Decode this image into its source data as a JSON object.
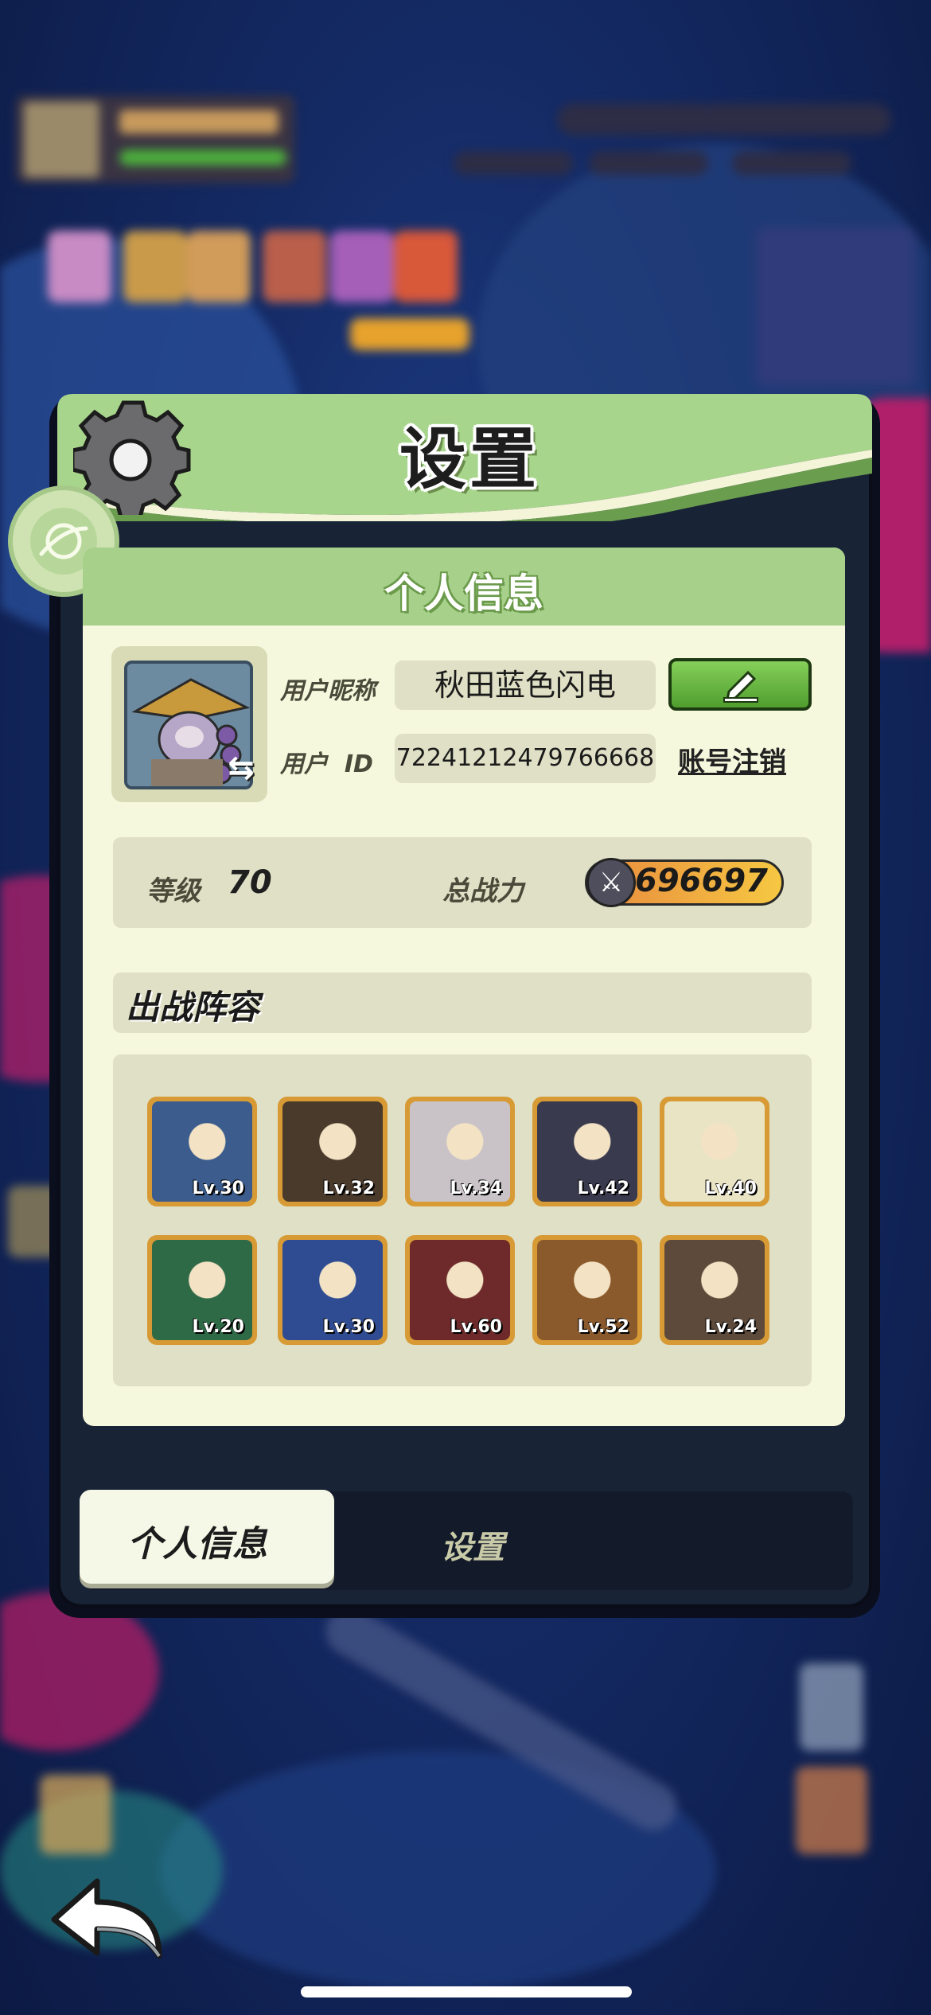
{
  "dialog": {
    "title": "设置",
    "card_title": "个人信息",
    "gear_icon": "gear-icon",
    "badge_icon": "planet-icon"
  },
  "profile": {
    "nickname_label": "用户昵称",
    "nickname": "秋田蓝色闪电",
    "id_label": "用户  ID",
    "user_id": "72241212479766668",
    "deactivate_link": "账号注销",
    "edit_icon": "pencil-icon",
    "swap_icon": "swap-icon"
  },
  "stats": {
    "level_label": "等级",
    "level": "70",
    "power_label": "总战力",
    "power": "696697",
    "power_icon": "crossed-swords-icon"
  },
  "lineup": {
    "title": "出战阵容",
    "heroes": [
      {
        "level": "Lv.30",
        "color": "#3b5c8c"
      },
      {
        "level": "Lv.32",
        "color": "#4a3a2c"
      },
      {
        "level": "Lv.34",
        "color": "#c9c3c8"
      },
      {
        "level": "Lv.42",
        "color": "#3a3a4e"
      },
      {
        "level": "Lv.40",
        "color": "#e9e4c4"
      },
      {
        "level": "Lv.20",
        "color": "#2f6a46"
      },
      {
        "level": "Lv.30",
        "color": "#2f4c93"
      },
      {
        "level": "Lv.60",
        "color": "#6e2a2a"
      },
      {
        "level": "Lv.52",
        "color": "#8a5a2c"
      },
      {
        "level": "Lv.24",
        "color": "#5e4a3a"
      }
    ]
  },
  "tabs": {
    "personal": "个人信息",
    "settings": "设置"
  },
  "nav": {
    "back_icon": "back-arrow-icon"
  }
}
